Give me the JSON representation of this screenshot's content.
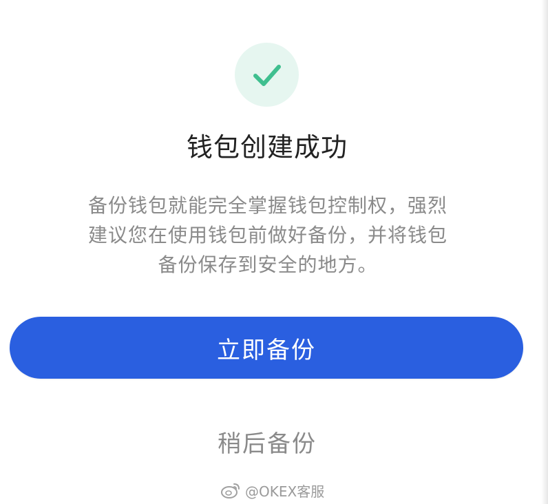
{
  "success": {
    "icon": "checkmark-icon",
    "badge_bg": "#e6f6f0",
    "check_color": "#3fbf8f"
  },
  "title": "钱包创建成功",
  "description": {
    "line1": "备份钱包就能完全掌握钱包控制权，强烈",
    "line2": "建议您在使用钱包前做好备份，并将钱包",
    "line3": "备份保存到安全的地方。"
  },
  "actions": {
    "backup_now": "立即备份",
    "backup_later": "稍后备份",
    "primary_color": "#2a5fe0"
  },
  "watermark": {
    "icon": "weibo-icon",
    "text": "@OKEX客服"
  }
}
